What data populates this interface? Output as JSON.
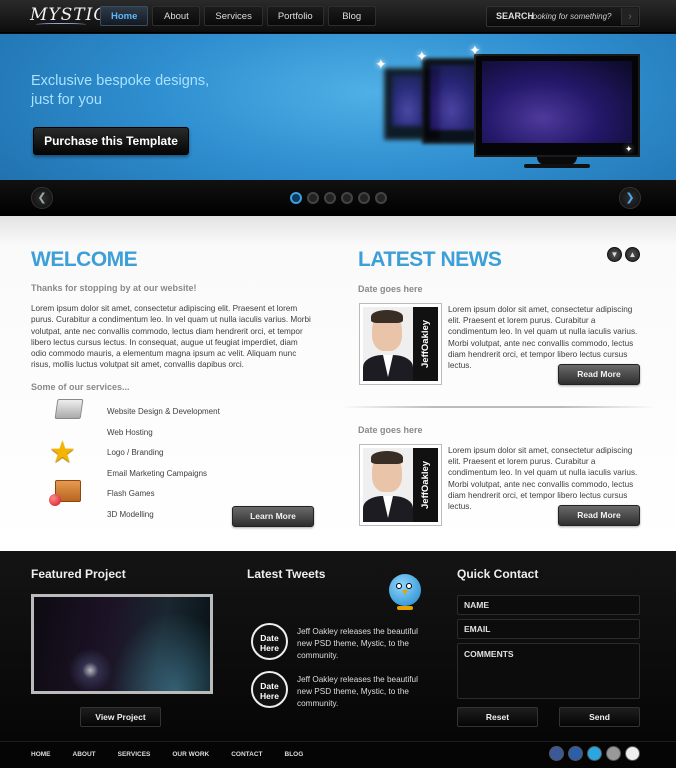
{
  "header": {
    "logo": "MYSTIC",
    "nav": [
      "Home",
      "About",
      "Services",
      "Portfolio",
      "Blog"
    ],
    "active_nav": "Home",
    "search_label": "SEARCH",
    "search_placeholder": "looking for something?"
  },
  "hero": {
    "tagline_line1": "Exclusive bespoke designs,",
    "tagline_line2": "just for you",
    "cta": "Purchase this Template",
    "slides": 6,
    "active_slide": 1
  },
  "welcome": {
    "title": "WELCOME",
    "subtitle": "Thanks for stopping by at our website!",
    "body": "Lorem ipsum dolor sit amet, consectetur adipiscing elit. Praesent et lorem purus. Curabitur a condimentum leo. In vel quam ut nulla iaculis varius. Morbi volutpat, ante nec convallis commodo, lectus diam hendrerit orci, et tempor libero lectus cursus lectus. In consequat, augue ut feugiat imperdiet, diam odio commodo mauris, a elementum magna ipsum ac velit. Aliquam nunc risus, mollis luctus volutpat sit amet, convallis dapibus orci.",
    "services_title": "Some of our services...",
    "services": [
      {
        "label": "Website Design & Development",
        "icon": "folder-icon"
      },
      {
        "label": "Web Hosting",
        "icon": ""
      },
      {
        "label": "Logo / Branding",
        "icon": "star-icon"
      },
      {
        "label": "Email Marketing Campaigns",
        "icon": ""
      },
      {
        "label": "Flash Games",
        "icon": "package-icon"
      },
      {
        "label": "3D Modelling",
        "icon": ""
      }
    ],
    "learn_more": "Learn More"
  },
  "news": {
    "title": "LATEST NEWS",
    "items": [
      {
        "date": "Date goes here",
        "badge": "JeffOakley",
        "text": "Lorem ipsum dolor sit amet, consectetur adipiscing elit. Praesent et lorem purus. Curabitur a condimentum leo. In vel quam ut nulla iaculis varius. Morbi volutpat, ante nec convallis commodo, lectus diam hendrerit orci, et tempor libero lectus cursus lectus.",
        "button": "Read More"
      },
      {
        "date": "Date goes here",
        "badge": "JeffOakley",
        "text": "Lorem ipsum dolor sit amet, consectetur adipiscing elit. Praesent et lorem purus. Curabitur a condimentum leo. In vel quam ut nulla iaculis varius. Morbi volutpat, ante nec convallis commodo, lectus diam hendrerit orci, et tempor libero lectus cursus lectus.",
        "button": "Read More"
      }
    ]
  },
  "footer": {
    "featured_title": "Featured Project",
    "view_project": "View Project",
    "tweets_title": "Latest Tweets",
    "tweets": [
      {
        "date_line1": "Date",
        "date_line2": "Here",
        "text": "Jeff Oakley releases the beautiful new PSD theme, Mystic, to the community."
      },
      {
        "date_line1": "Date",
        "date_line2": "Here",
        "text": "Jeff Oakley releases the beautiful new PSD theme, Mystic, to the community."
      }
    ],
    "contact_title": "Quick Contact",
    "name_placeholder": "NAME",
    "email_placeholder": "EMAIL",
    "comments_placeholder": "COMMENTS",
    "reset": "Reset",
    "send": "Send"
  },
  "bottom_nav": [
    "HOME",
    "ABOUT",
    "SERVICES",
    "OUR WORK",
    "CONTACT",
    "BLOG"
  ],
  "social_icons": [
    "facebook-icon",
    "digg-icon",
    "twitter-icon",
    "delicious-icon",
    "flickr-icon"
  ],
  "colors": {
    "accent": "#3c9fd8",
    "hero_blue": "#2f8fd0",
    "dark": "#0c0c0c"
  }
}
